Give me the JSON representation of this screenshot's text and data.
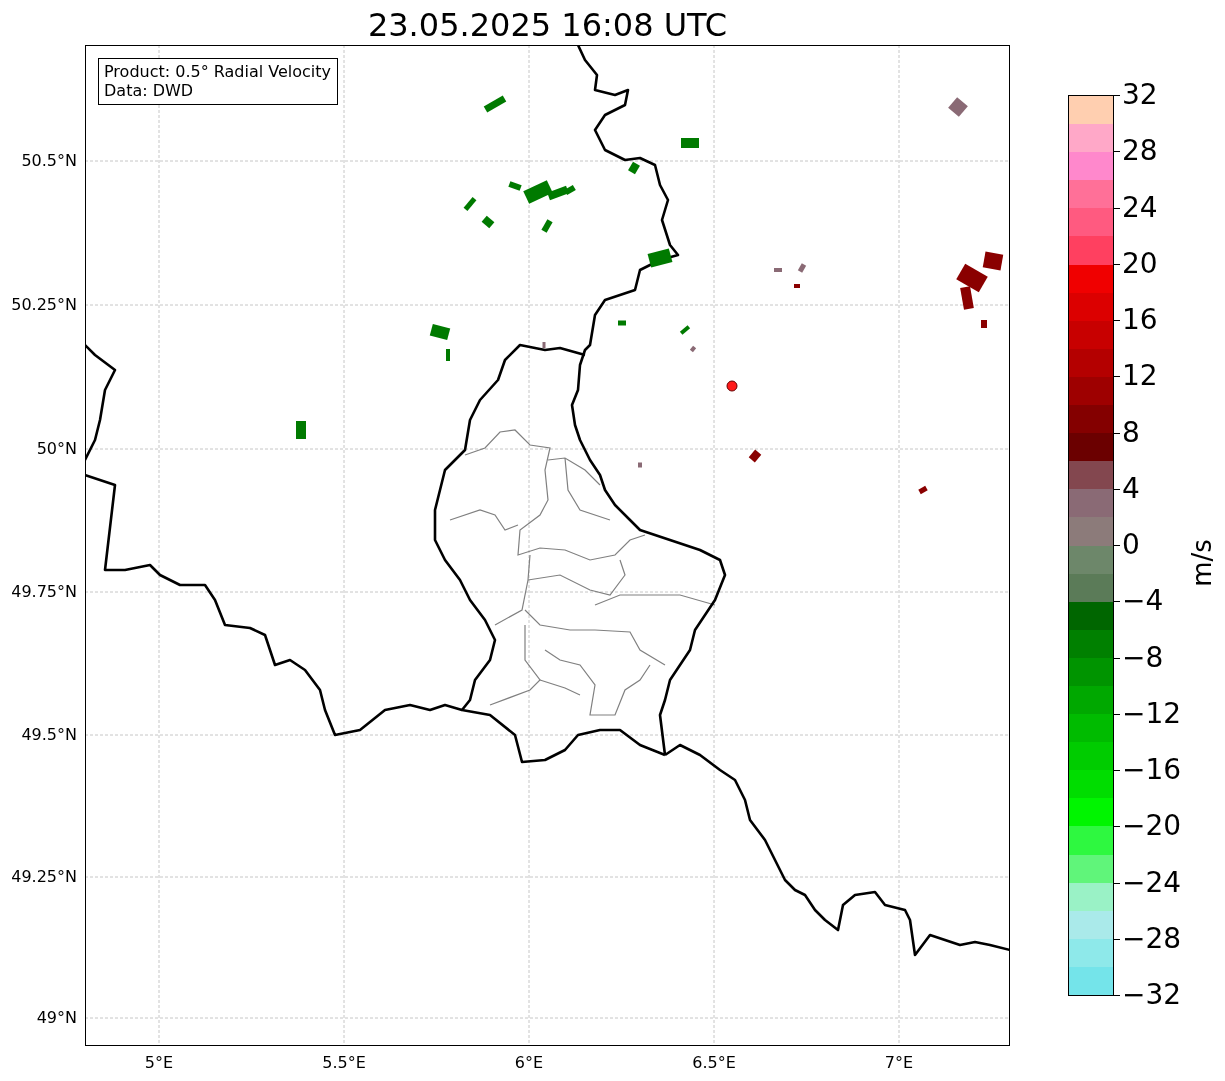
{
  "title": "23.05.2025 16:08 UTC",
  "info_box": [
    "Product: 0.5° Radial Velocity",
    "Data: DWD"
  ],
  "x_ticks": [
    "5°E",
    "5.5°E",
    "6°E",
    "6.5°E",
    "7°E"
  ],
  "y_ticks": [
    "50.5°N",
    "50.25°N",
    "50°N",
    "49.75°N",
    "49.5°N",
    "49.25°N",
    "49°N"
  ],
  "colorbar": {
    "label": "m/s",
    "ticks": [
      "32",
      "28",
      "24",
      "20",
      "16",
      "12",
      "8",
      "4",
      "0",
      "−4",
      "−8",
      "−12",
      "−16",
      "−20",
      "−24",
      "−28",
      "−32"
    ],
    "bands": [
      {
        "color": "#74e4ea"
      },
      {
        "color": "#8ee9ea"
      },
      {
        "color": "#aaeaea"
      },
      {
        "color": "#9af2c6"
      },
      {
        "color": "#60f57a"
      },
      {
        "color": "#2ef840"
      },
      {
        "color": "#00f500"
      },
      {
        "color": "#00dd00"
      },
      {
        "color": "#00cc00"
      },
      {
        "color": "#00bb00"
      },
      {
        "color": "#00a800"
      },
      {
        "color": "#009400"
      },
      {
        "color": "#008000"
      },
      {
        "color": "#006600"
      },
      {
        "color": "#5b7b58"
      },
      {
        "color": "#6d876a"
      },
      {
        "color": "#8c7b7a"
      },
      {
        "color": "#8a6a75"
      },
      {
        "color": "#83474f"
      },
      {
        "color": "#6b0000"
      },
      {
        "color": "#840000"
      },
      {
        "color": "#9e0000"
      },
      {
        "color": "#b40000"
      },
      {
        "color": "#c80000"
      },
      {
        "color": "#dc0000"
      },
      {
        "color": "#f00000"
      },
      {
        "color": "#ff4060"
      },
      {
        "color": "#ff5a80"
      },
      {
        "color": "#ff7098"
      },
      {
        "color": "#ff88cc"
      },
      {
        "color": "#ffa8c8"
      },
      {
        "color": "#ffcfb0"
      }
    ]
  }
}
